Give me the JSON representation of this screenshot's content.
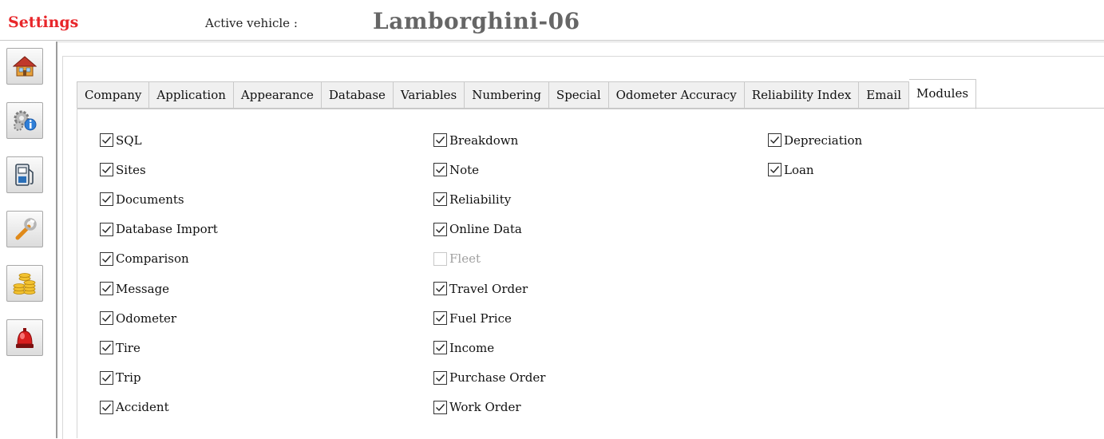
{
  "header": {
    "title": "Settings",
    "active_vehicle_label": "Active vehicle :",
    "active_vehicle_value": "Lamborghini-06"
  },
  "sidebar": {
    "items": [
      {
        "icon": "home-icon"
      },
      {
        "icon": "gears-info-icon"
      },
      {
        "icon": "fuel-pump-icon"
      },
      {
        "icon": "wrench-icon"
      },
      {
        "icon": "coins-icon"
      },
      {
        "icon": "alarm-bell-icon"
      }
    ]
  },
  "tabs": [
    {
      "label": "Company"
    },
    {
      "label": "Application"
    },
    {
      "label": "Appearance"
    },
    {
      "label": "Database"
    },
    {
      "label": "Variables"
    },
    {
      "label": "Numbering"
    },
    {
      "label": "Special"
    },
    {
      "label": "Odometer Accuracy"
    },
    {
      "label": "Reliability Index"
    },
    {
      "label": "Email"
    },
    {
      "label": "Modules",
      "active": true
    }
  ],
  "modules": {
    "col1": [
      {
        "label": "SQL",
        "checked": true
      },
      {
        "label": "Sites",
        "checked": true
      },
      {
        "label": "Documents",
        "checked": true
      },
      {
        "label": "Database Import",
        "checked": true
      },
      {
        "label": "Comparison",
        "checked": true
      },
      {
        "label": "Message",
        "checked": true
      },
      {
        "label": "Odometer",
        "checked": true
      },
      {
        "label": "Tire",
        "checked": true
      },
      {
        "label": "Trip",
        "checked": true
      },
      {
        "label": "Accident",
        "checked": true
      }
    ],
    "col2": [
      {
        "label": "Breakdown",
        "checked": true
      },
      {
        "label": "Note",
        "checked": true
      },
      {
        "label": "Reliability",
        "checked": true
      },
      {
        "label": "Online Data",
        "checked": true
      },
      {
        "label": "Fleet",
        "checked": false,
        "disabled": true
      },
      {
        "label": "Travel Order",
        "checked": true
      },
      {
        "label": "Fuel Price",
        "checked": true
      },
      {
        "label": "Income",
        "checked": true
      },
      {
        "label": "Purchase Order",
        "checked": true
      },
      {
        "label": "Work Order",
        "checked": true
      }
    ],
    "col3": [
      {
        "label": "Depreciation",
        "checked": true
      },
      {
        "label": "Loan",
        "checked": true
      }
    ]
  },
  "colors": {
    "title_red": "#e8262a",
    "vehicle_gray": "#666666"
  }
}
